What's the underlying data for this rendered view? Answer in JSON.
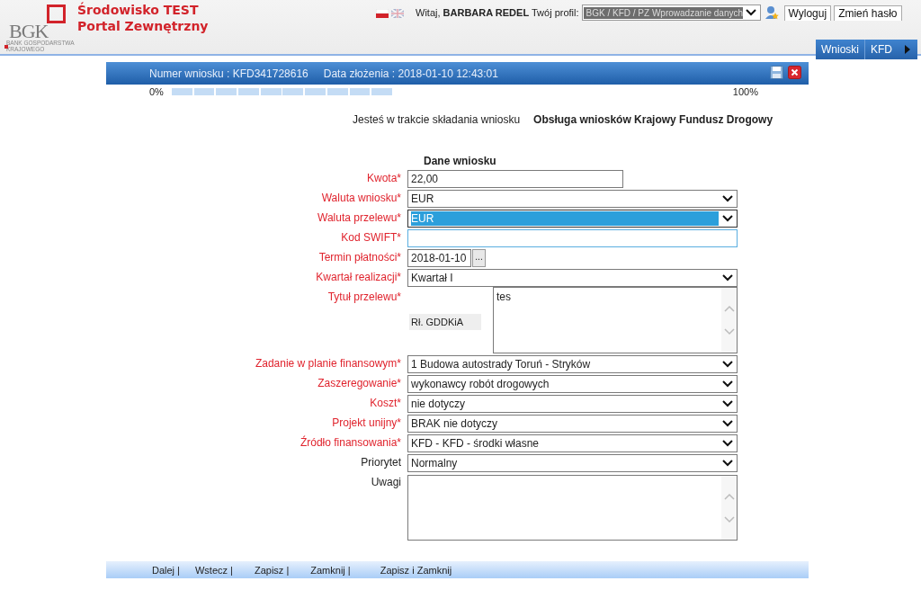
{
  "header": {
    "logo": {
      "text": "BGK",
      "tagline": "BANK GOSPODARSTWA KRAJOWEGO"
    },
    "title_lines": [
      "Środowisko TEST",
      "Portal Zewnętrzny"
    ],
    "languages": [
      {
        "kind": "pl",
        "selected": true
      },
      {
        "kind": "en",
        "selected": false
      }
    ],
    "greeting": "Witaj, **BARBARA REDEL** Twój profil:",
    "profile": "BGK / KFD / PZ Wprowadzanie danych",
    "buttons": [
      "Wyloguj",
      "Zmień hasło"
    ]
  },
  "nav": {
    "items": [
      "Wnioski",
      "KFD"
    ]
  },
  "panel": {
    "title_fields": [
      "Numer wniosku : KFD341728616",
      "Data złożenia : 2018-01-10 12:43:01"
    ],
    "progress": {
      "start_label": "0%",
      "end_label": "100%"
    },
    "intro": {
      "text": "Jesteś w trakcie składania wniosku",
      "process": "Obsługa wniosków Krajowy Fundusz Drogowy"
    },
    "section_title": "Dane wniosku",
    "fields": [
      {
        "kind": "text",
        "label": "Kwota*",
        "required": true,
        "value": "22,00",
        "focused": false
      },
      {
        "kind": "select",
        "label": "Waluta wniosku*",
        "required": true,
        "value": "EUR",
        "highlighted": false
      },
      {
        "kind": "select",
        "label": "Waluta przelewu*",
        "required": true,
        "value": "EUR",
        "highlighted": true
      },
      {
        "kind": "text",
        "label": "Kod SWIFT*",
        "required": true,
        "focused": true
      },
      {
        "kind": "date",
        "label": "Termin płatności*",
        "required": true,
        "value": "2018-01-10",
        "button": "..."
      },
      {
        "kind": "select",
        "label": "Kwartał realizacji*",
        "required": true,
        "value": "Kwartał I",
        "highlighted": false
      },
      {
        "kind": "tagged-textarea",
        "label": "Tytuł przelewu*",
        "required": true,
        "tag": "Rł. GDDKiA",
        "value": "tes"
      },
      {
        "kind": "select",
        "label": "Zadanie w planie finansowym*",
        "required": true,
        "value": "1 Budowa autostrady Toruń - Stryków",
        "highlighted": false
      },
      {
        "kind": "select",
        "label": "Zaszeregowanie*",
        "required": true,
        "value": "wykonawcy robót drogowych",
        "highlighted": false
      },
      {
        "kind": "select",
        "label": "Koszt*",
        "required": true,
        "value": "nie dotyczy",
        "highlighted": false
      },
      {
        "kind": "select",
        "label": "Projekt unijny*",
        "required": true,
        "value": "BRAK nie dotyczy",
        "highlighted": false
      },
      {
        "kind": "select",
        "label": "Źródło finansowania*",
        "required": true,
        "value": "KFD - KFD - środki własne",
        "highlighted": false
      },
      {
        "kind": "select",
        "label": "Priorytet",
        "required": false,
        "value": "Normalny",
        "highlighted": false
      },
      {
        "kind": "textarea",
        "label": "Uwagi",
        "required": false
      }
    ],
    "footer_links": [
      "Dalej |",
      "Wstecz |",
      "Zapisz |",
      "Zamknij |",
      "Zapisz i Zamknij"
    ]
  }
}
